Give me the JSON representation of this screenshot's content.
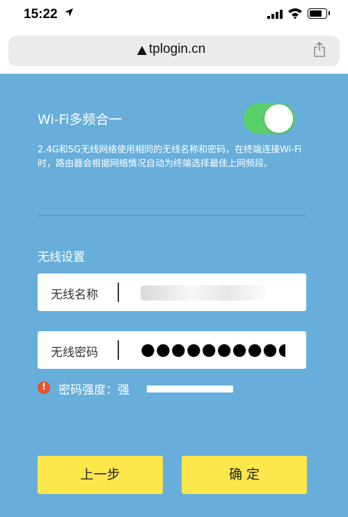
{
  "status_bar": {
    "time": "15:22"
  },
  "browser": {
    "url": "tplogin.cn"
  },
  "wifi_merge": {
    "title": "Wi-Fi多频合一",
    "enabled": true,
    "description": "2.4G和5G无线网络使用相同的无线名称和密码，在终端连接Wi-Fi时，路由器会根据网络情况自动为终端选择最佳上网频段。"
  },
  "wireless_settings": {
    "section_title": "无线设置",
    "name_label": "无线名称",
    "password_label": "无线密码",
    "password_mask": "●●●●●●●●●●●●",
    "strength_text": "密码强度：强",
    "strength_level": 1.0
  },
  "buttons": {
    "prev": "上一步",
    "confirm": "确 定"
  },
  "colors": {
    "panel": "#67aedb",
    "toggle_on": "#5cd068",
    "button": "#fde84c",
    "warning": "#e4552a"
  }
}
